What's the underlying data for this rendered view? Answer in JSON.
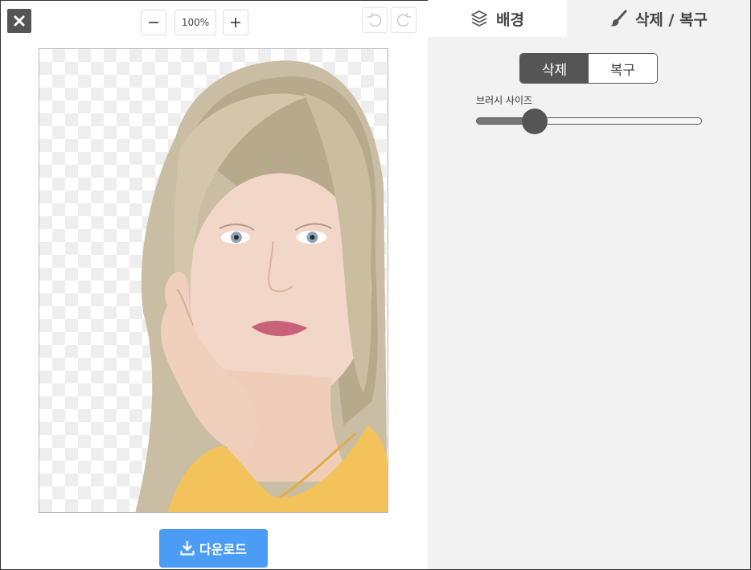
{
  "toolbar": {
    "close_icon": "close-icon",
    "zoom_out_icon": "minus-icon",
    "zoom_level": "100%",
    "zoom_in_icon": "plus-icon",
    "undo_icon": "undo-icon",
    "redo_icon": "redo-icon"
  },
  "canvas": {
    "image_desc_icon": "portrait-photo"
  },
  "download": {
    "label": "다운로드",
    "icon": "download-icon"
  },
  "panel": {
    "tabs": [
      {
        "label": "배경",
        "icon": "layers-icon",
        "active": false
      },
      {
        "label": "삭제 / 복구",
        "icon": "brush-icon",
        "active": true
      }
    ],
    "mode": {
      "options": [
        "삭제",
        "복구"
      ],
      "selected": "삭제"
    },
    "brush_size": {
      "label": "브러시 사이즈",
      "value_fraction": 0.26
    }
  },
  "colors": {
    "accent": "#4a9cf5",
    "dark": "#555555",
    "panel_bg": "#f2f2f2"
  }
}
